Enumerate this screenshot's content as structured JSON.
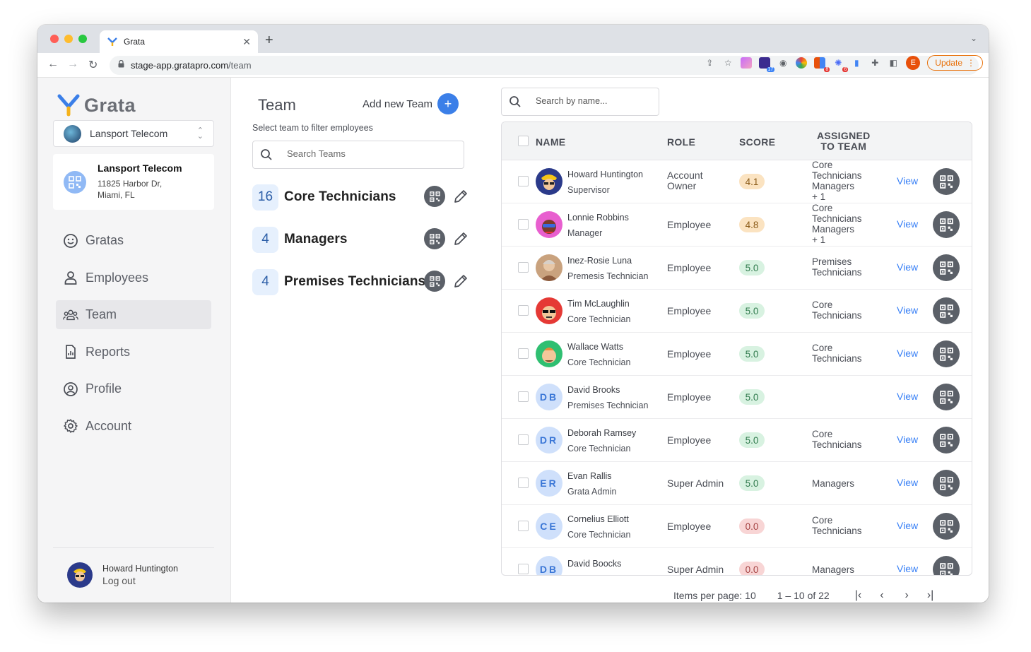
{
  "browser": {
    "tab_title": "Grata",
    "url_host": "stage-app.gratapro.com",
    "url_path": "/team",
    "update_label": "Update",
    "profile_initial": "E",
    "ext_badges": [
      "17",
      "8",
      "6"
    ]
  },
  "sidebar": {
    "app_name": "Grata",
    "org_select": "Lansport Telecom",
    "org_card": {
      "name": "Lansport Telecom",
      "address1": "11825 Harbor Dr,",
      "address2": "Miami, FL"
    },
    "nav": [
      {
        "label": "Gratas",
        "icon": "smile-icon"
      },
      {
        "label": "Employees",
        "icon": "person-icon"
      },
      {
        "label": "Team",
        "icon": "team-icon",
        "active": true
      },
      {
        "label": "Reports",
        "icon": "report-icon"
      },
      {
        "label": "Profile",
        "icon": "profile-icon"
      },
      {
        "label": "Account",
        "icon": "gear-icon"
      }
    ],
    "user": {
      "name": "Howard Huntington",
      "logout": "Log out"
    }
  },
  "teams_panel": {
    "title": "Team",
    "add_label": "Add new Team",
    "add_symbol": "+",
    "subtitle": "Select team to filter employees",
    "search_placeholder": "Search Teams",
    "teams": [
      {
        "count": "16",
        "name": "Core Technicians"
      },
      {
        "count": "4",
        "name": "Managers"
      },
      {
        "count": "4",
        "name": "Premises Technicians"
      }
    ]
  },
  "employees": {
    "search_placeholder": "Search by name...",
    "columns": {
      "name": "NAME",
      "role": "ROLE",
      "score": "SCORE",
      "team_l1": "ASSIGNED",
      "team_l2": "TO TEAM"
    },
    "view_label": "View",
    "rows": [
      {
        "name": "Howard Huntington",
        "title": "Supervisor",
        "role": [
          "Account",
          "Owner"
        ],
        "score": "4.1",
        "score_kind": "warn",
        "teams": [
          "Core",
          "Technicians",
          "Managers",
          "+ 1"
        ],
        "avatar": "police",
        "initials": ""
      },
      {
        "name": "Lonnie Robbins",
        "title": "Manager",
        "role": [
          "Employee"
        ],
        "score": "4.8",
        "score_kind": "warn",
        "teams": [
          "Core",
          "Technicians",
          "Managers",
          "+ 1"
        ],
        "avatar": "pink",
        "initials": ""
      },
      {
        "name": "Inez-Rosie Luna",
        "title": "Premesis Technician",
        "role": [
          "Employee"
        ],
        "score": "5.0",
        "score_kind": "good",
        "teams": [
          "Premises",
          "Technicians"
        ],
        "avatar": "photo",
        "initials": ""
      },
      {
        "name": "Tim McLaughlin",
        "title": "Core Technician",
        "role": [
          "Employee"
        ],
        "score": "5.0",
        "score_kind": "good",
        "teams": [
          "Core",
          "Technicians"
        ],
        "avatar": "red",
        "initials": ""
      },
      {
        "name": "Wallace Watts",
        "title": "Core Technician",
        "role": [
          "Employee"
        ],
        "score": "5.0",
        "score_kind": "good",
        "teams": [
          "Core",
          "Technicians"
        ],
        "avatar": "green",
        "initials": ""
      },
      {
        "name": "David Brooks",
        "title": "Premises Technician",
        "role": [
          "Employee"
        ],
        "score": "5.0",
        "score_kind": "good",
        "teams": [],
        "avatar": "init",
        "initials": "DB"
      },
      {
        "name": "Deborah Ramsey",
        "title": "Core Technician",
        "role": [
          "Employee"
        ],
        "score": "5.0",
        "score_kind": "good",
        "teams": [
          "Core",
          "Technicians"
        ],
        "avatar": "init",
        "initials": "DR"
      },
      {
        "name": "Evan Rallis",
        "title": "Grata Admin",
        "role": [
          "Super Admin"
        ],
        "score": "5.0",
        "score_kind": "good",
        "teams": [
          "Managers"
        ],
        "avatar": "init",
        "initials": "ER"
      },
      {
        "name": "Cornelius Elliott",
        "title": "Core Technician",
        "role": [
          "Employee"
        ],
        "score": "0.0",
        "score_kind": "bad",
        "teams": [
          "Core",
          "Technicians"
        ],
        "avatar": "init",
        "initials": "CE"
      },
      {
        "name": "David Boocks",
        "title": "",
        "role": [
          "Super Admin"
        ],
        "score": "0.0",
        "score_kind": "bad",
        "teams": [
          "Managers"
        ],
        "avatar": "init",
        "initials": "DB"
      }
    ]
  },
  "pagination": {
    "items_per_page": "Items per page: 10",
    "range": "1 – 10 of 22"
  },
  "colors": {
    "accent": "#3b7fe8",
    "score_warn_bg": "#fbe3c1",
    "score_good_bg": "#d8f2e1",
    "score_bad_bg": "#f8d5d5"
  }
}
